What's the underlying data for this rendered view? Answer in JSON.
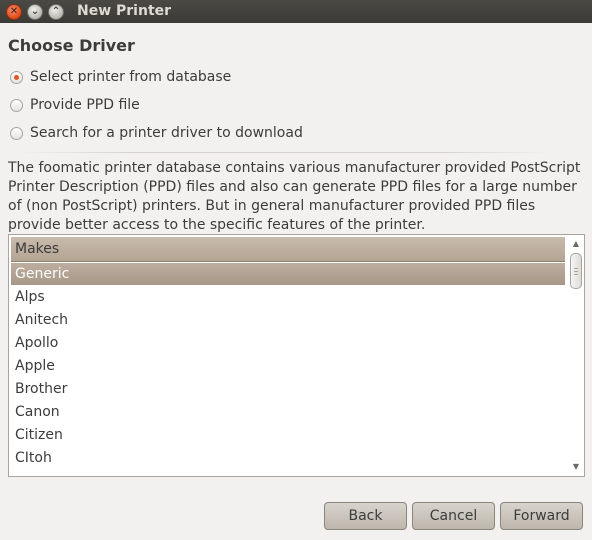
{
  "window": {
    "title": "New Printer",
    "close_glyph": "✕",
    "minimize_glyph": "⌄",
    "maximize_glyph": "⌃"
  },
  "page": {
    "heading": "Choose Driver"
  },
  "options": [
    {
      "label": "Select printer from database",
      "checked": true
    },
    {
      "label": "Provide PPD file",
      "checked": false
    },
    {
      "label": "Search for a printer driver to download",
      "checked": false
    }
  ],
  "description": "The foomatic printer database contains various manufacturer provided PostScript Printer Description (PPD) files and also can generate PPD files for a large number of (non PostScript) printers. But in general manufacturer provided PPD files provide better access to the specific features of the printer.",
  "makes": {
    "header": "Makes",
    "items": [
      "Generic",
      "Alps",
      "Anitech",
      "Apollo",
      "Apple",
      "Brother",
      "Canon",
      "Citizen",
      "CItoh"
    ],
    "selected": "Generic"
  },
  "buttons": {
    "back": "Back",
    "cancel": "Cancel",
    "forward": "Forward"
  },
  "colors": {
    "accent": "#e0571f",
    "selection": "#b3a493"
  }
}
